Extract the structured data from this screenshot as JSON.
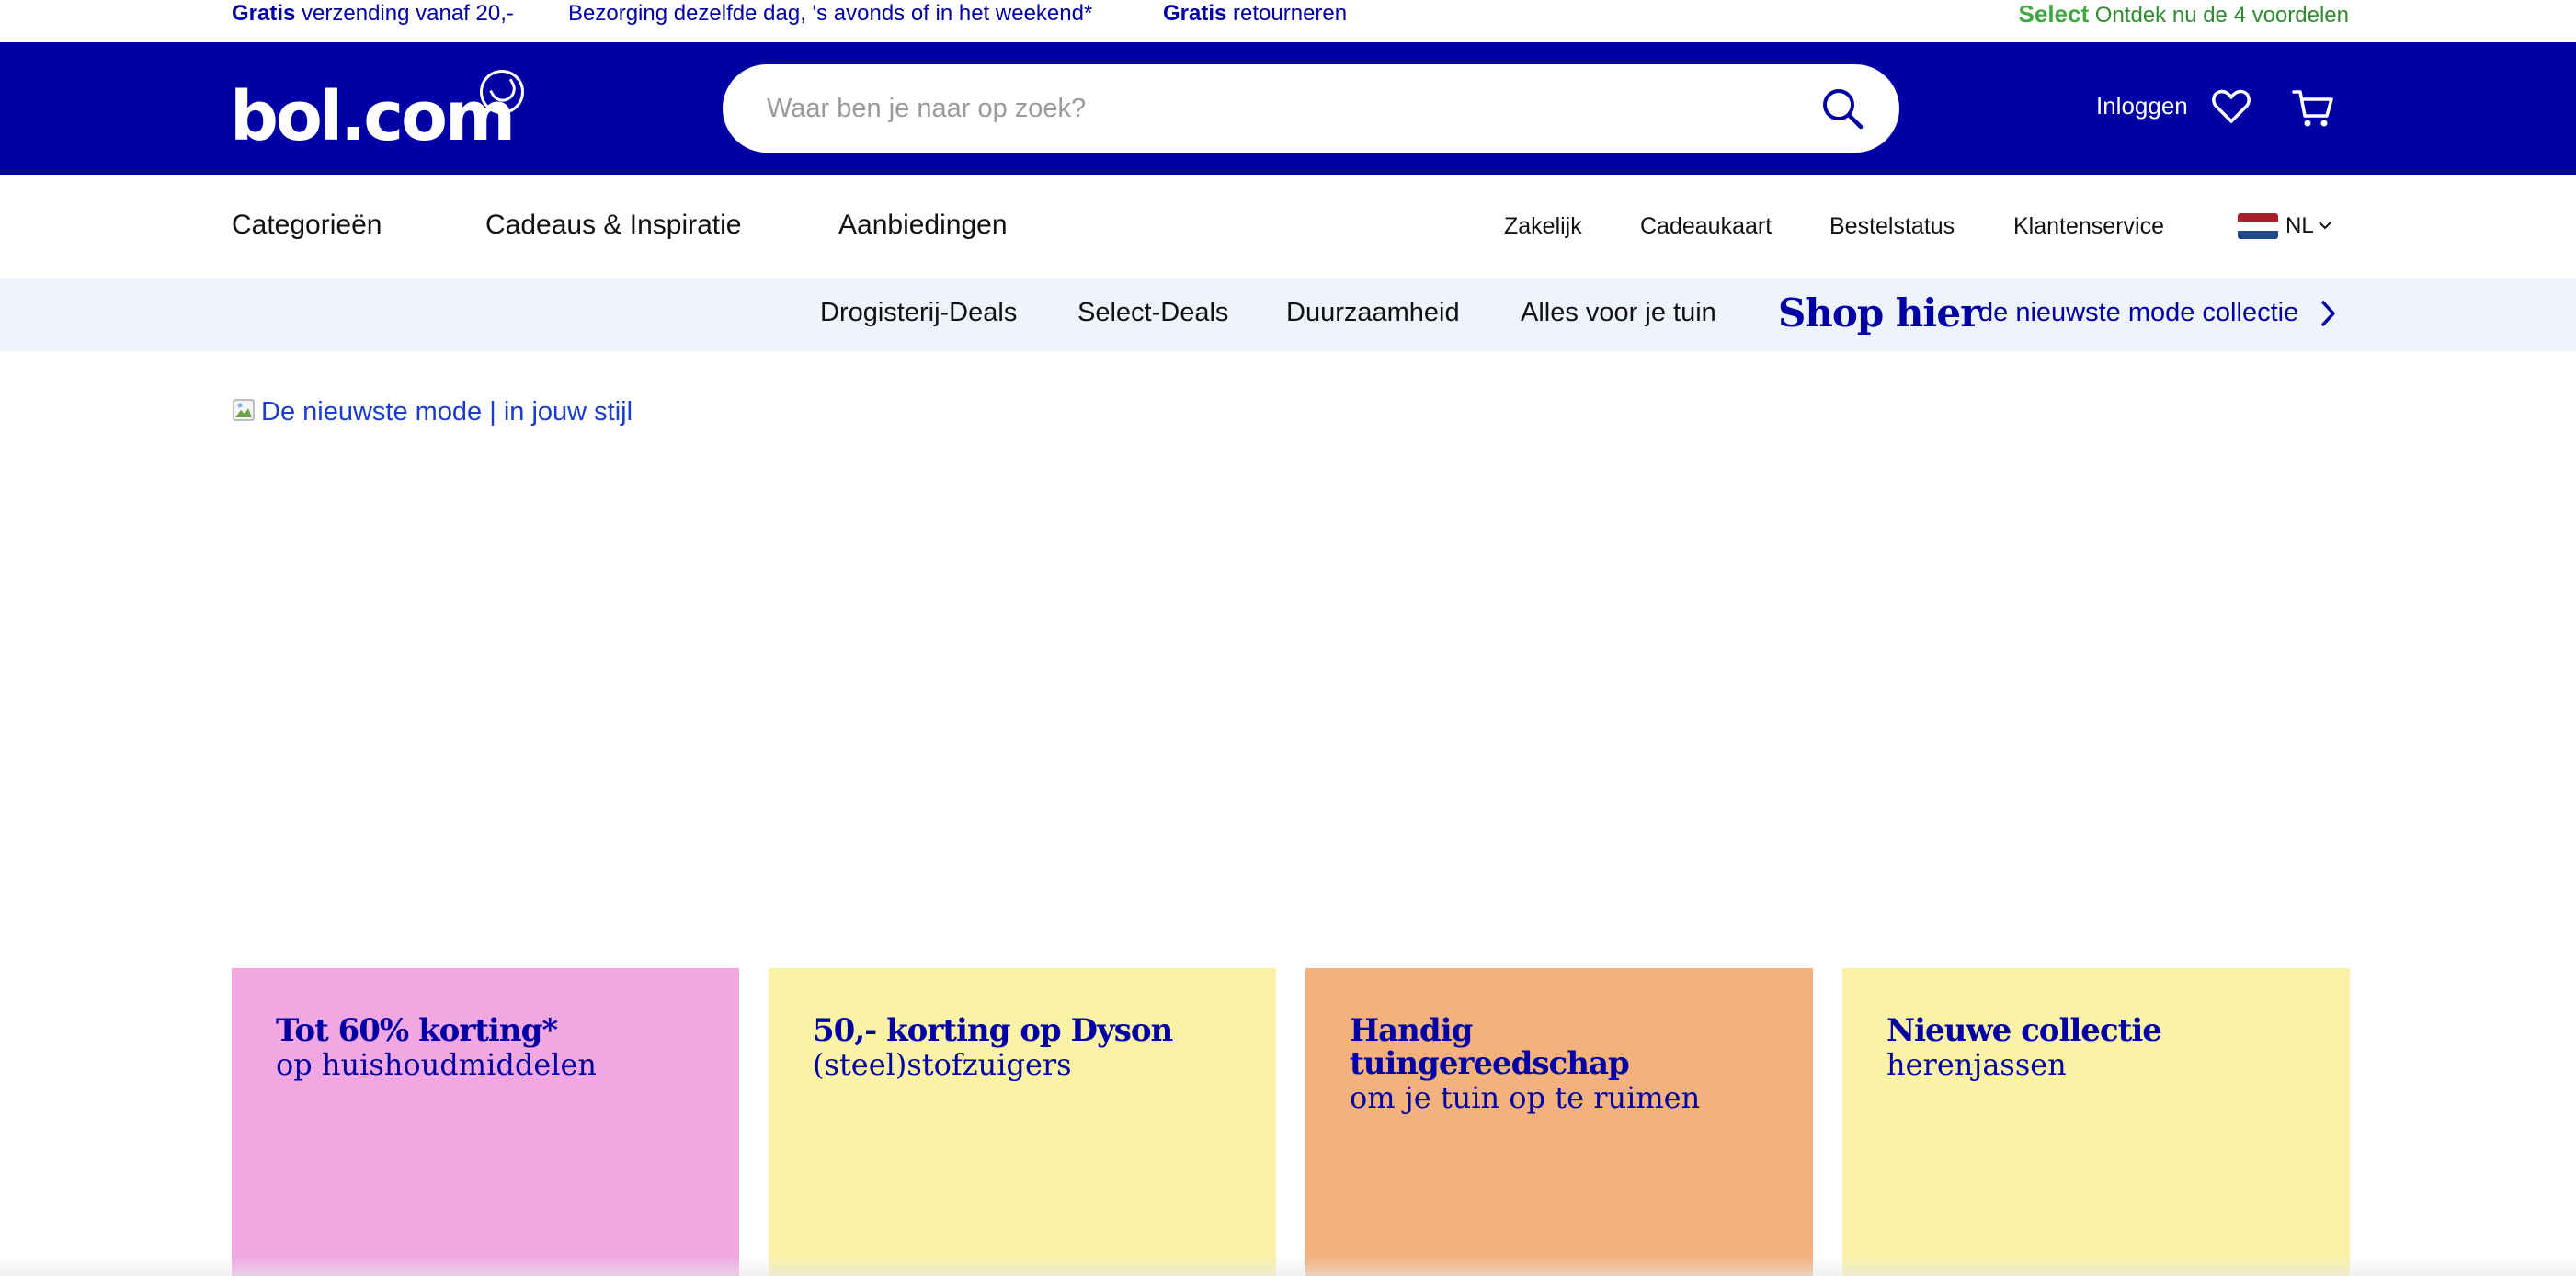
{
  "usp_bar": {
    "item1_bold": "Gratis",
    "item1_text": " verzending vanaf 20,-",
    "item2_text": "Bezorging dezelfde dag, 's avonds of in het weekend*",
    "item3_bold": "Gratis",
    "item3_text": " retourneren",
    "select_bold": "Select",
    "select_text": " Ontdek nu de 4 voordelen"
  },
  "header": {
    "logo_text": "bol.com",
    "search_placeholder": "Waar ben je naar op zoek?",
    "login_label": "Inloggen",
    "icons": [
      "search-icon",
      "heart-icon",
      "cart-icon"
    ]
  },
  "nav": {
    "main": [
      "Categorieën",
      "Cadeaus & Inspiratie",
      "Aanbiedingen"
    ],
    "secondary": [
      "Zakelijk",
      "Cadeaukaart",
      "Bestelstatus",
      "Klantenservice"
    ],
    "language": "NL"
  },
  "deals_bar": {
    "items": [
      "Drogisterij-Deals",
      "Select-Deals",
      "Duurzaamheid",
      "Alles voor je tuin"
    ],
    "shop_hier": "Shop hier",
    "shop_sub": "de nieuwste mode collectie"
  },
  "banner": {
    "alt_text": "De nieuwste mode | in jouw stijl"
  },
  "cards": [
    {
      "title": "Tot 60% korting*",
      "subtitle": "op huishoudmiddelen",
      "color": "#f1a8e2"
    },
    {
      "title": "50,- korting op Dyson",
      "subtitle": "(steel)stofzuigers",
      "color": "#faf2a7"
    },
    {
      "title": "Handig tuingereedschap",
      "subtitle": "om je tuin op te ruimen",
      "color": "#f3b17d"
    },
    {
      "title": "Nieuwe collectie",
      "subtitle": "herenjassen",
      "color": "#faf2a7"
    }
  ],
  "colors": {
    "brand_blue": "#0000a4",
    "select_green": "#3fa83f",
    "deals_bg": "#eff3fb"
  }
}
